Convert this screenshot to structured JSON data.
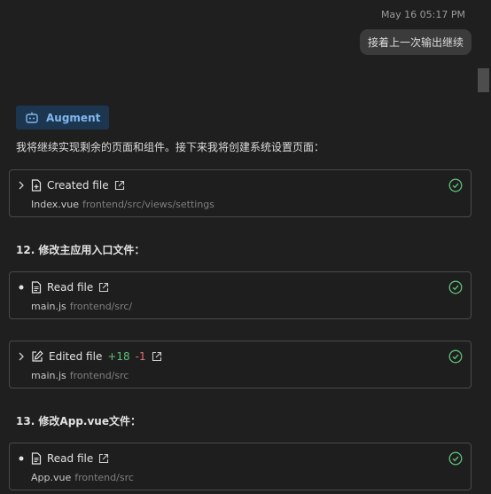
{
  "header": {
    "timestamp": "May 16 05:17 PM",
    "user_message": "接着上一次输出继续"
  },
  "assistant": {
    "badge_label": "Augment",
    "intro": "我将继续实现剩余的页面和组件。接下来我将创建系统设置页面：",
    "heading_12": "12. 修改主应用入口文件：",
    "heading_13": "13. 修改App.vue文件："
  },
  "cards": [
    {
      "action": "Created file",
      "file": "Index.vue",
      "path": "frontend/src/views/settings",
      "lead": "chevron-right-icon",
      "icon": "file-plus-icon"
    },
    {
      "action": "Read file",
      "file": "main.js",
      "path": "frontend/src/",
      "lead": "bullet",
      "icon": "file-text-icon"
    },
    {
      "action": "Edited file",
      "added": "+18",
      "removed": "-1",
      "file": "main.js",
      "path": "frontend/src",
      "lead": "chevron-right-icon",
      "icon": "edit-icon"
    },
    {
      "action": "Read file",
      "file": "App.vue",
      "path": "frontend/src",
      "lead": "bullet",
      "icon": "file-text-icon"
    }
  ],
  "colors": {
    "accent": "#7fb8ef",
    "success": "#5fbf77",
    "added": "#5fbf77",
    "removed": "#e07070"
  }
}
